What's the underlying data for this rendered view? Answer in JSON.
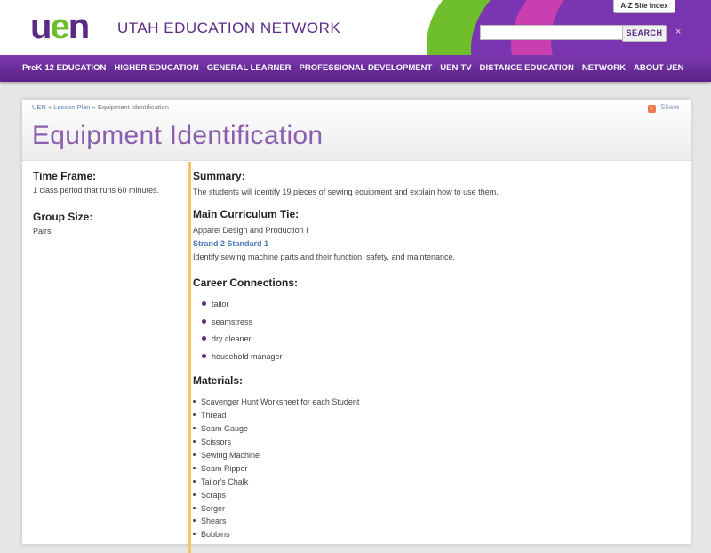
{
  "header": {
    "logo": {
      "u": "u",
      "e": "e",
      "n": "n"
    },
    "site_name": "UTAH EDUCATION NETWORK",
    "az_index": "A-Z Site Index",
    "search": {
      "value": "",
      "placeholder": "",
      "button": "SEARCH"
    },
    "close_glyph": "×",
    "colors": {
      "purple": "#5b2a86",
      "green": "#6fbf2c"
    }
  },
  "nav": {
    "items": [
      "PreK-12 EDUCATION",
      "HIGHER EDUCATION",
      "GENERAL LEARNER",
      "PROFESSIONAL DEVELOPMENT",
      "UEN-TV",
      "DISTANCE EDUCATION",
      "NETWORK",
      "ABOUT UEN"
    ]
  },
  "breadcrumb": {
    "root": "UEN",
    "sep": "»",
    "section": "Lesson Plan",
    "current": "Equipment Identification"
  },
  "share": {
    "label": "Share",
    "icon": "share-icon"
  },
  "page": {
    "title": "Equipment Identification",
    "time_frame": {
      "label": "Time Frame:",
      "value": "1 class period that runs 60 minutes."
    },
    "group_size": {
      "label": "Group Size:",
      "value": "Pairs"
    },
    "summary": {
      "label": "Summary:",
      "text": "The students will identify 19 pieces of sewing equipment and explain how to use them."
    },
    "curriculum": {
      "label": "Main Curriculum Tie:",
      "course": "Apparel Design and Production I",
      "strand": "Strand 2 Standard 1",
      "text": "Identify sewing machine parts and their function, safety, and maintenance."
    },
    "career": {
      "label": "Career Connections:",
      "items": [
        "tailor",
        "seamstress",
        "dry cleaner",
        "household manager"
      ]
    },
    "materials": {
      "label": "Materials:",
      "items": [
        "Scavenger Hunt Worksheet for each Student",
        "Thread",
        "Seam Gauge",
        "Scissors",
        "Sewing Machine",
        "Seam Ripper",
        "Tailor's Chalk",
        "Scraps",
        "Serger",
        "Shears",
        "Bobbins"
      ]
    }
  }
}
